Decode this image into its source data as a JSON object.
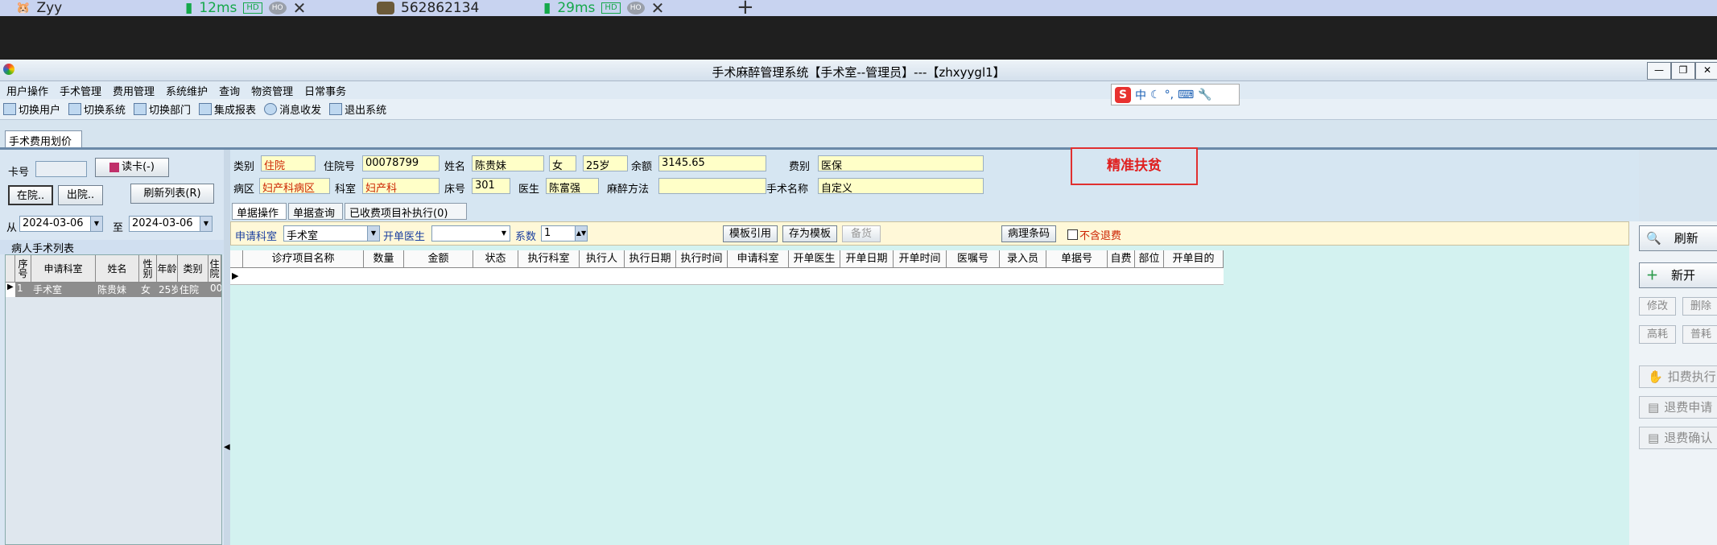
{
  "browser": {
    "tabs": [
      {
        "name": "Zyy",
        "latency": "",
        "hd": "",
        "ho": ""
      },
      {
        "name": "",
        "latency": "12ms",
        "hd": "HD",
        "ho": "HO"
      },
      {
        "name": "562862134",
        "latency": "",
        "hd": "",
        "ho": ""
      },
      {
        "name": "",
        "latency": "29ms",
        "hd": "HD",
        "ho": "HO"
      }
    ],
    "close_glyph": "✕",
    "new_tab_glyph": "+"
  },
  "window": {
    "title": "手术麻醉管理系统【手术室--管理员】---【zhxyygl1】",
    "controls": [
      "—",
      "❐",
      "✕"
    ]
  },
  "menu": [
    "用户操作",
    "手术管理",
    "费用管理",
    "系统维护",
    "查询",
    "物资管理",
    "日常事务"
  ],
  "toolbar": [
    "切换用户",
    "切换系统",
    "切换部门",
    "集成报表",
    "消息收发",
    "退出系统"
  ],
  "ime": {
    "logo": "S",
    "label": "中"
  },
  "doc_tab": "手术费用划价",
  "left": {
    "card_label": "卡号",
    "card_value": "",
    "read_card": "读卡(-)",
    "inpatient": "在院..",
    "discharged": "出院..",
    "refresh_list": "刷新列表(R)",
    "from_label": "从",
    "from_date": "2024-03-06",
    "to_label": "至",
    "to_date": "2024-03-06",
    "list_title": "病人手术列表",
    "columns": [
      "序号",
      "申请科室",
      "姓名",
      "性别",
      "年龄",
      "类别",
      "住院"
    ],
    "rows": [
      [
        "1",
        "手术室",
        "陈贵妹",
        "女",
        "25岁",
        "住院",
        "00"
      ]
    ]
  },
  "patient": {
    "type_label": "类别",
    "type": "住院",
    "inpatient_no_label": "住院号",
    "inpatient_no": "00078799",
    "name_label": "姓名",
    "name": "陈贵妹",
    "sex": "女",
    "age": "25岁",
    "balance_label": "余额",
    "balance": "3145.65",
    "fee_type_label": "费别",
    "fee_type": "医保",
    "ward_label": "病区",
    "ward": "妇产科病区",
    "dept_label": "科室",
    "dept": "妇产科",
    "bed_label": "床号",
    "bed": "301",
    "doctor_label": "医生",
    "doctor": "陈富强",
    "anesthesia_label": "麻醉方法",
    "anesthesia": "",
    "surgery_label": "手术名称",
    "surgery": "自定义",
    "poverty_tag": "精准扶贫"
  },
  "subtabs": [
    "单据操作",
    "单据查询",
    "已收费项目补执行(0)"
  ],
  "filter": {
    "apply_dept_label": "申请科室",
    "apply_dept": "手术室",
    "order_doctor_label": "开单医生",
    "order_doctor": "",
    "coef_label": "系数",
    "coef": "1",
    "template_ref": "模板引用",
    "save_template": "存为模板",
    "stock": "备货",
    "pathology": "病理条码",
    "no_refund": "不含退费"
  },
  "grid": {
    "columns": [
      "诊疗项目名称",
      "数量",
      "金额",
      "状态",
      "执行科室",
      "执行人",
      "执行日期",
      "执行时间",
      "申请科室",
      "开单医生",
      "开单日期",
      "开单时间",
      "医嘱号",
      "录入员",
      "单据号",
      "自费",
      "部位",
      "开单目的"
    ]
  },
  "actions": {
    "refresh": "刷新",
    "new": "新开",
    "edit": "修改",
    "delete": "删除",
    "high_cost": "高耗",
    "common_cost": "普耗",
    "deduct": "扣费执行",
    "refund_apply": "退费申请",
    "refund_confirm": "退费确认"
  }
}
